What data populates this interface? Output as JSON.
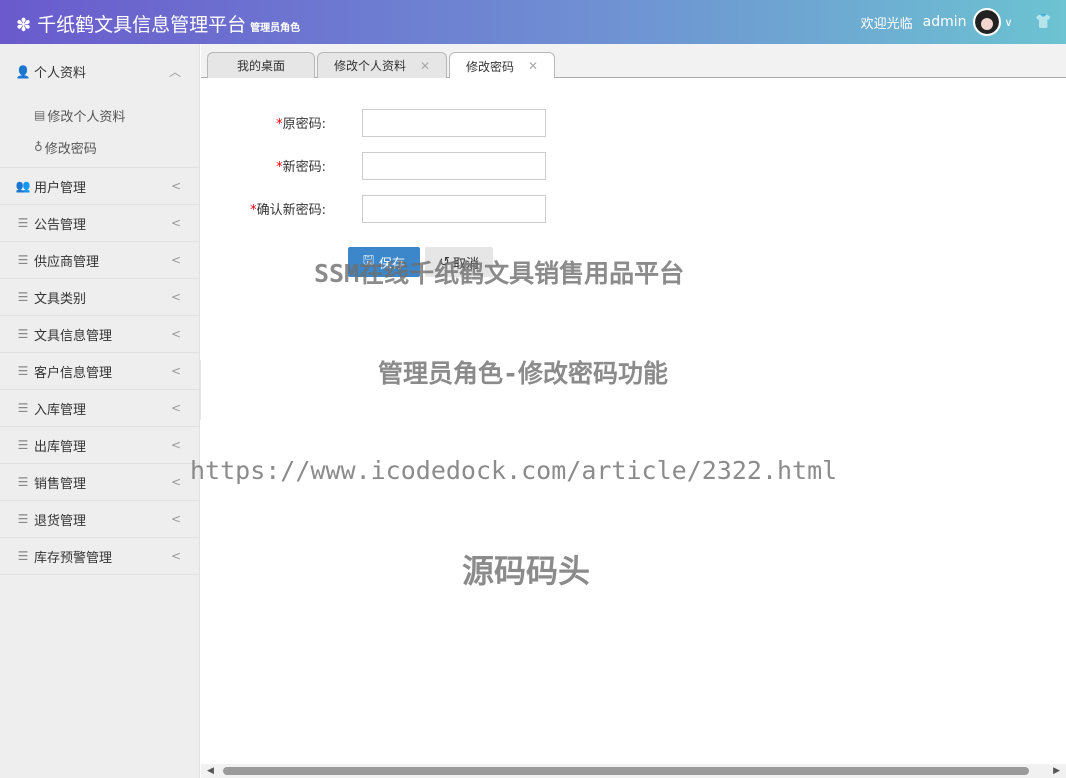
{
  "header": {
    "logo_icon": "gear-flower-icon",
    "title": "千纸鹤文具信息管理平台",
    "subtitle": "管理员角色",
    "welcome": "欢迎光临",
    "username": "admin",
    "caret": "∨",
    "skin_icon": "tshirt-icon"
  },
  "sidebar": {
    "profile": {
      "label": "个人资料",
      "arrow": "︿"
    },
    "sub_items": [
      {
        "label": "修改个人资料",
        "icon": "edit-icon"
      },
      {
        "label": "修改密码",
        "icon": "key-icon"
      }
    ],
    "items": [
      {
        "label": "用户管理",
        "icon": "users-icon"
      },
      {
        "label": "公告管理",
        "icon": "list-icon"
      },
      {
        "label": "供应商管理",
        "icon": "list-icon"
      },
      {
        "label": "文具类别",
        "icon": "list-icon"
      },
      {
        "label": "文具信息管理",
        "icon": "list-icon"
      },
      {
        "label": "客户信息管理",
        "icon": "list-icon"
      },
      {
        "label": "入库管理",
        "icon": "list-icon"
      },
      {
        "label": "出库管理",
        "icon": "list-icon"
      },
      {
        "label": "销售管理",
        "icon": "list-icon"
      },
      {
        "label": "退货管理",
        "icon": "list-icon"
      },
      {
        "label": "库存预警管理",
        "icon": "list-icon"
      }
    ],
    "arrow": "<"
  },
  "tabs": [
    {
      "label": "我的桌面",
      "closable": false
    },
    {
      "label": "修改个人资料",
      "closable": true
    },
    {
      "label": "修改密码",
      "closable": true,
      "active": true
    }
  ],
  "form": {
    "old_password_label": "原密码:",
    "new_password_label": "新密码:",
    "confirm_password_label": "确认新密码:",
    "required_mark": "*",
    "old_password_value": "",
    "new_password_value": "",
    "confirm_password_value": "",
    "save_label": "保存",
    "cancel_label": "取消"
  },
  "watermarks": {
    "line1": "SSM在线千纸鹤文具销售用品平台",
    "line2": "管理员角色-修改密码功能",
    "line3": "https://www.icodedock.com/article/2322.html",
    "line4": "源码码头"
  },
  "colors": {
    "header_gradient_start": "#6a5acd",
    "header_gradient_end": "#6cc3d1",
    "save_button": "#3b87c9",
    "required": "#e00000"
  }
}
